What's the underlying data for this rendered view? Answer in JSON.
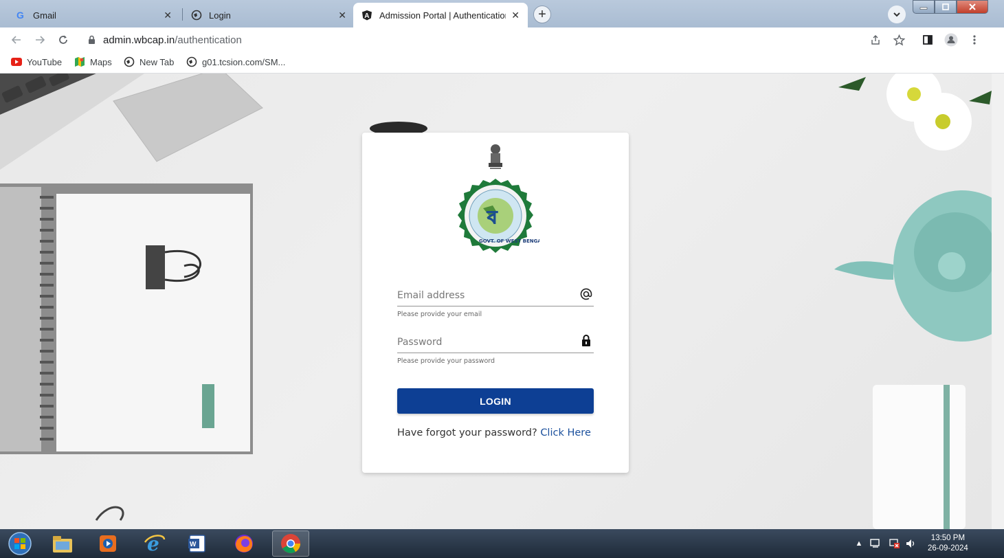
{
  "browser": {
    "tabs": [
      {
        "title": "Gmail",
        "icon": "google-icon",
        "active": false
      },
      {
        "title": "Login",
        "icon": "globe-icon",
        "active": false
      },
      {
        "title": "Admission Portal | Authentication",
        "icon": "angular-icon",
        "active": true
      }
    ],
    "new_tab_label": "+",
    "address": {
      "host": "admin.wbcap.in",
      "path": "/authentication"
    },
    "bookmarks": [
      {
        "label": "YouTube",
        "icon": "youtube-icon"
      },
      {
        "label": "Maps",
        "icon": "maps-icon"
      },
      {
        "label": "New Tab",
        "icon": "globe-icon"
      },
      {
        "label": "g01.tcsion.com/SM...",
        "icon": "globe-icon"
      }
    ]
  },
  "login": {
    "emblem_text": "GOVT. OF WEST BENGAL",
    "email": {
      "placeholder": "Email address",
      "helper": "Please provide your email",
      "icon": "at-icon"
    },
    "password": {
      "placeholder": "Password",
      "helper": "Please provide your password",
      "icon": "lock-icon"
    },
    "login_button": "LOGIN",
    "forgot_text": "Have forgot your password?",
    "forgot_link": "Click Here"
  },
  "taskbar": {
    "apps": [
      "start-orb-icon",
      "file-explorer-icon",
      "media-player-icon",
      "internet-explorer-icon",
      "word-icon",
      "firefox-icon",
      "chrome-icon"
    ],
    "time": "13:50 PM",
    "date": "26-09-2024"
  },
  "colors": {
    "login_button": "#0d3f94",
    "link": "#1a4f9c",
    "seal_green": "#1f7a3a"
  }
}
